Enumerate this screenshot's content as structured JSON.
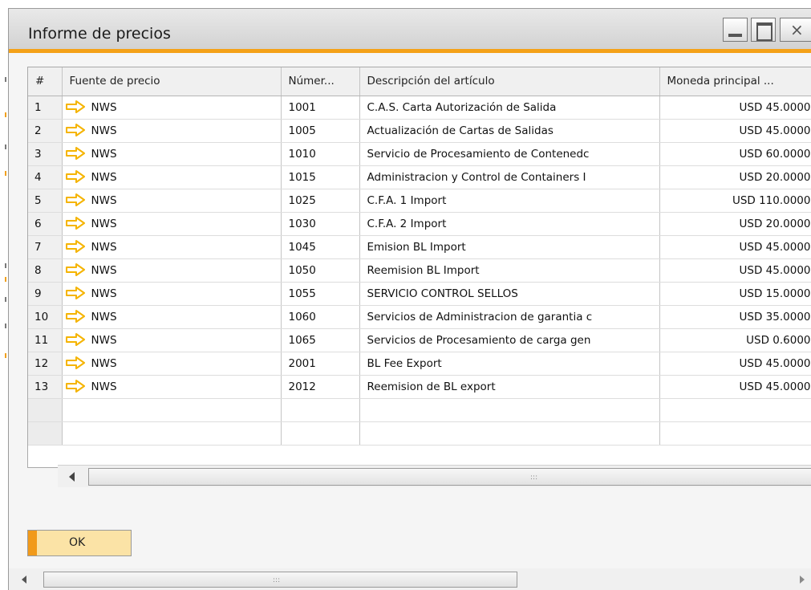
{
  "window": {
    "title": "Informe de precios",
    "close_label": "×"
  },
  "colors": {
    "accent_orange": "#f4a118",
    "ok_button_fill": "#fbe3a6",
    "arrow_icon": "#f5b400"
  },
  "grid": {
    "columns": [
      "#",
      "Fuente de precio",
      "Númer...",
      "Descripción del artículo",
      "Moneda principal ..."
    ],
    "rows": [
      {
        "idx": "1",
        "source": "NWS",
        "number": "1001",
        "description": "C.A.S. Carta Autorización de Salida",
        "price": "USD 45.0000"
      },
      {
        "idx": "2",
        "source": "NWS",
        "number": "1005",
        "description": "Actualización de Cartas de Salidas",
        "price": "USD 45.0000"
      },
      {
        "idx": "3",
        "source": "NWS",
        "number": "1010",
        "description": "Servicio de Procesamiento de Contenedc",
        "price": "USD 60.0000"
      },
      {
        "idx": "4",
        "source": "NWS",
        "number": "1015",
        "description": "Administracion y Control de Containers I",
        "price": "USD 20.0000"
      },
      {
        "idx": "5",
        "source": "NWS",
        "number": "1025",
        "description": "C.F.A.  1   Import",
        "price": "USD 110.0000"
      },
      {
        "idx": "6",
        "source": "NWS",
        "number": "1030",
        "description": "C.F.A.  2   Import",
        "price": "USD 20.0000"
      },
      {
        "idx": "7",
        "source": "NWS",
        "number": "1045",
        "description": "Emision BL Import",
        "price": "USD 45.0000"
      },
      {
        "idx": "8",
        "source": "NWS",
        "number": "1050",
        "description": "Reemision BL Import",
        "price": "USD 45.0000"
      },
      {
        "idx": "9",
        "source": "NWS",
        "number": "1055",
        "description": "SERVICIO CONTROL SELLOS",
        "price": "USD 15.0000"
      },
      {
        "idx": "10",
        "source": "NWS",
        "number": "1060",
        "description": "Servicios de Administracion de garantia c",
        "price": "USD 35.0000"
      },
      {
        "idx": "11",
        "source": "NWS",
        "number": "1065",
        "description": "Servicios de Procesamiento de carga gen",
        "price": "USD 0.6000"
      },
      {
        "idx": "12",
        "source": "NWS",
        "number": "2001",
        "description": "BL Fee Export",
        "price": "USD 45.0000"
      },
      {
        "idx": "13",
        "source": "NWS",
        "number": "2012",
        "description": "Reemision de  BL  export",
        "price": "USD 45.0000"
      }
    ],
    "empty_rows": 2,
    "row_icon": "yellow-right-arrow-icon"
  },
  "footer": {
    "ok_label": "OK"
  }
}
